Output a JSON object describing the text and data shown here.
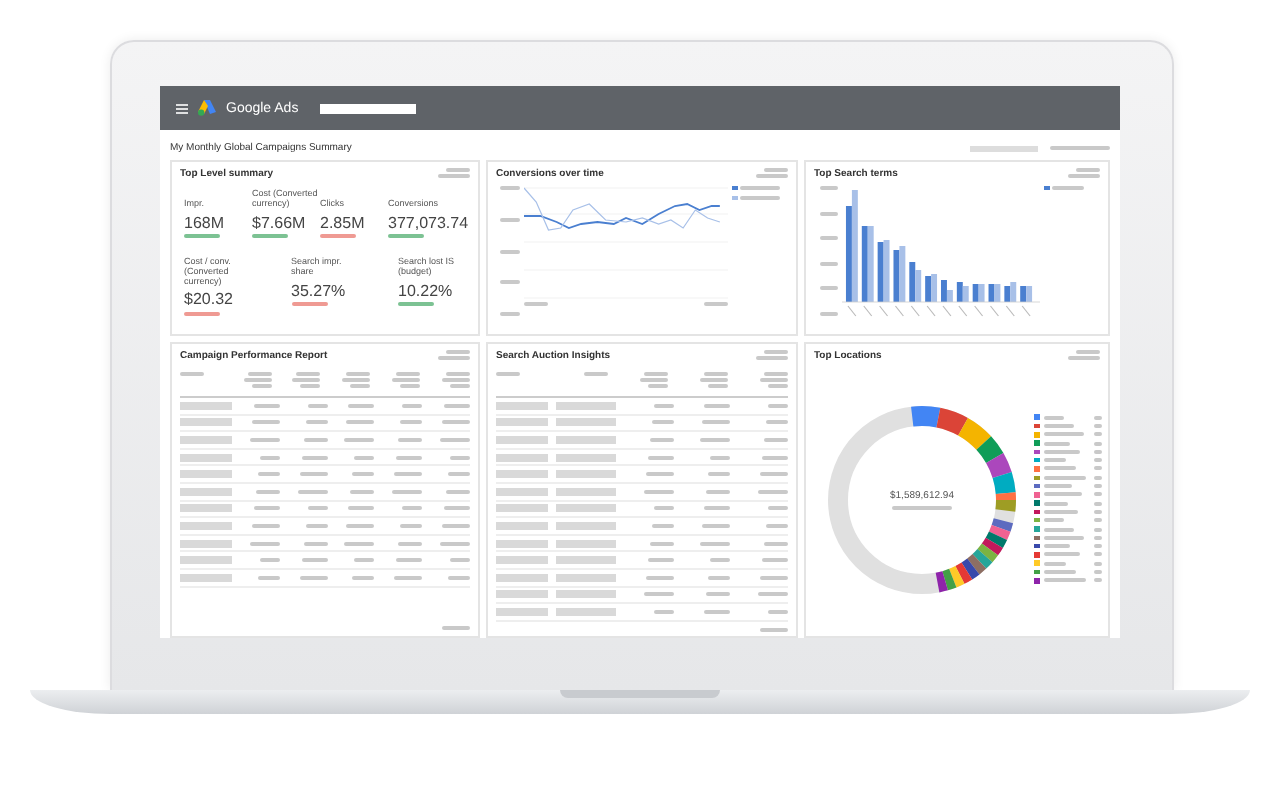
{
  "app": {
    "name": "Google Ads"
  },
  "report": {
    "title": "My Monthly Global Campaigns Summary"
  },
  "summary": {
    "title": "Top Level summary",
    "metric_rows": [
      [
        {
          "label": "Impr.",
          "value": "168M",
          "positive": true
        },
        {
          "label": "Cost (Converted currency)",
          "value": "$7.66M",
          "positive": true
        },
        {
          "label": "Clicks",
          "value": "2.85M",
          "positive": false
        },
        {
          "label": "Conversions",
          "value": "377,073.74",
          "positive": true
        }
      ],
      [
        {
          "label": "Cost / conv. (Converted currency)",
          "value": "$20.32",
          "positive": false
        },
        {
          "label": "Search impr. share",
          "value": "35.27%",
          "positive": false
        },
        {
          "label": "Search lost IS (budget)",
          "value": "10.22%",
          "positive": true
        }
      ]
    ]
  },
  "conversions": {
    "title": "Conversions over time",
    "legend": [
      {
        "color": "#4a7fd0"
      },
      {
        "color": "#a8c0e8"
      }
    ]
  },
  "search_terms": {
    "title": "Top Search terms",
    "legend": [
      {
        "color": "#4a7fd0"
      }
    ]
  },
  "campaigns": {
    "title": "Campaign Performance Report"
  },
  "auction": {
    "title": "Search Auction Insights"
  },
  "locations": {
    "title": "Top Locations",
    "total": "$1,589,612.94",
    "items": [
      {
        "color": "#4285f4"
      },
      {
        "color": "#db4437"
      },
      {
        "color": "#f4b400"
      },
      {
        "color": "#0f9d58"
      },
      {
        "color": "#ab47bc"
      },
      {
        "color": "#00acc1"
      },
      {
        "color": "#ff7043"
      },
      {
        "color": "#9e9d24"
      },
      {
        "color": "#5c6bc0"
      },
      {
        "color": "#f06292"
      },
      {
        "color": "#00796b"
      },
      {
        "color": "#c2185b"
      },
      {
        "color": "#7cb342"
      },
      {
        "color": "#26a69a"
      },
      {
        "color": "#8d6e63"
      },
      {
        "color": "#3949ab"
      },
      {
        "color": "#e53935"
      },
      {
        "color": "#ffca28"
      },
      {
        "color": "#43a047"
      },
      {
        "color": "#8e24aa"
      }
    ]
  }
}
